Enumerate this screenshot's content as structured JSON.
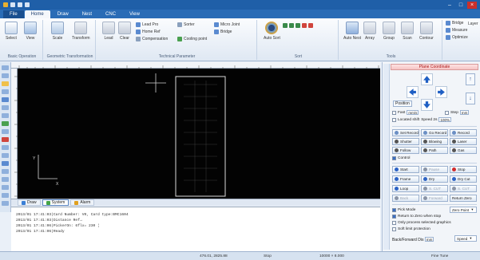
{
  "window": {
    "title": ""
  },
  "ribbon_tabs": [
    "File",
    "Home",
    "Draw",
    "Nest",
    "CNC",
    "View"
  ],
  "ribbon": {
    "groups": [
      {
        "label": "Basic Operation",
        "buttons": [
          "Select",
          "View"
        ]
      },
      {
        "label": "Geometric Transformation",
        "buttons": [
          "Scale",
          "Transform"
        ]
      },
      {
        "label": "Technical Parameter",
        "buttons": [
          "Lead",
          "Clear"
        ],
        "small": [
          "Lead Pro",
          "Home Ref",
          "Compensation",
          "Sorter",
          "Cooling point",
          "Micro Joint",
          "Bridge"
        ]
      },
      {
        "label": "Sort",
        "buttons": [
          "Auto Sort"
        ]
      },
      {
        "label": "Tools",
        "buttons": [
          "Auto Nest",
          "Array",
          "Group",
          "Scan",
          "Contour"
        ]
      },
      {
        "label": "Layer",
        "buttons": [
          "Layer"
        ],
        "small": [
          "Bridge",
          "Measure",
          "Optimize"
        ]
      }
    ]
  },
  "log_tabs": [
    {
      "label": "Draw",
      "color": "#3a7fd6"
    },
    {
      "label": "System",
      "color": "#45a547"
    },
    {
      "label": "Alarm",
      "color": "#e0a020"
    }
  ],
  "log_lines": [
    "2013/01 17:41:03|Card Number: V0, Card type:BMC1604",
    "2013/01 17:41:03|Distance Ref→",
    "2013/01 17:41:06|PickerOn: 6flx= 230 ¦",
    "2013/01 17:41:06|Ready"
  ],
  "panel": {
    "header": "Plane Coordinate",
    "position_button": "Position",
    "fast": {
      "label": "Fast",
      "value": "mm/s"
    },
    "step": {
      "label": "Step",
      "value": "mm"
    },
    "located": {
      "label": "Located shift",
      "speed_label": "Speed 2s",
      "value": "100%"
    },
    "controls": [
      {
        "label": "Set Record",
        "color": "#6b8fc4",
        "disabled": false
      },
      {
        "label": "Go Record",
        "color": "#6b8fc4",
        "disabled": false
      },
      {
        "label": "Record",
        "color": "#6b8fc4",
        "disabled": false
      },
      {
        "label": "Shutter",
        "color": "#555555",
        "disabled": false
      },
      {
        "label": "Blowing",
        "color": "#555555",
        "disabled": false
      },
      {
        "label": "Laser",
        "color": "#555555",
        "disabled": false
      },
      {
        "label": "Follow",
        "color": "#555555",
        "disabled": false
      },
      {
        "label": "Path",
        "color": "#555555",
        "disabled": false
      },
      {
        "label": "Gas",
        "color": "#555555",
        "disabled": false
      }
    ],
    "control_label": "Control",
    "run_buttons": [
      {
        "label": "Start",
        "color": "#2c62c4",
        "disabled": false
      },
      {
        "label": "Pause",
        "color": "#8a94a6",
        "disabled": true
      },
      {
        "label": "Stop",
        "color": "#d12b2b",
        "disabled": false
      },
      {
        "label": "Frame",
        "color": "#2c62c4",
        "disabled": false
      },
      {
        "label": "Dry",
        "color": "#2c62c4",
        "disabled": false
      },
      {
        "label": "Dry Cut",
        "color": "#2c62c4",
        "disabled": false
      },
      {
        "label": "Loop",
        "color": "#2c62c4",
        "disabled": false
      },
      {
        "label": "S. CUT",
        "color": "#8a94a6",
        "disabled": true
      },
      {
        "label": "S. CUT",
        "color": "#8a94a6",
        "disabled": true
      },
      {
        "label": "Back",
        "color": "#8a94a6",
        "disabled": true
      },
      {
        "label": "Forward",
        "color": "#8a94a6",
        "disabled": true
      },
      {
        "label": "Return Zero",
        "color": "#8a94a6",
        "disabled": false
      }
    ],
    "options": [
      {
        "label": "Pick Mode",
        "checked": true
      },
      {
        "label": "Return to Zero when stop",
        "checked": true
      },
      {
        "label": "Only process selected graphics",
        "checked": false
      },
      {
        "label": "Soft limit protection",
        "checked": false
      }
    ],
    "zero_dropdown": "Zero Point",
    "back_forward": {
      "label": "Back/Forward Dis",
      "value": "mm",
      "speed": "Speed"
    }
  },
  "status": {
    "coords": "476.01, 2825.88",
    "mode": "Stop",
    "plate": "10000 × 8.000",
    "extra": "Fine Tune"
  },
  "colors": {
    "canvas_bg": "#030303",
    "ribbon_tab_bg": "#2a6cb6",
    "panel_header": "#a11111"
  }
}
